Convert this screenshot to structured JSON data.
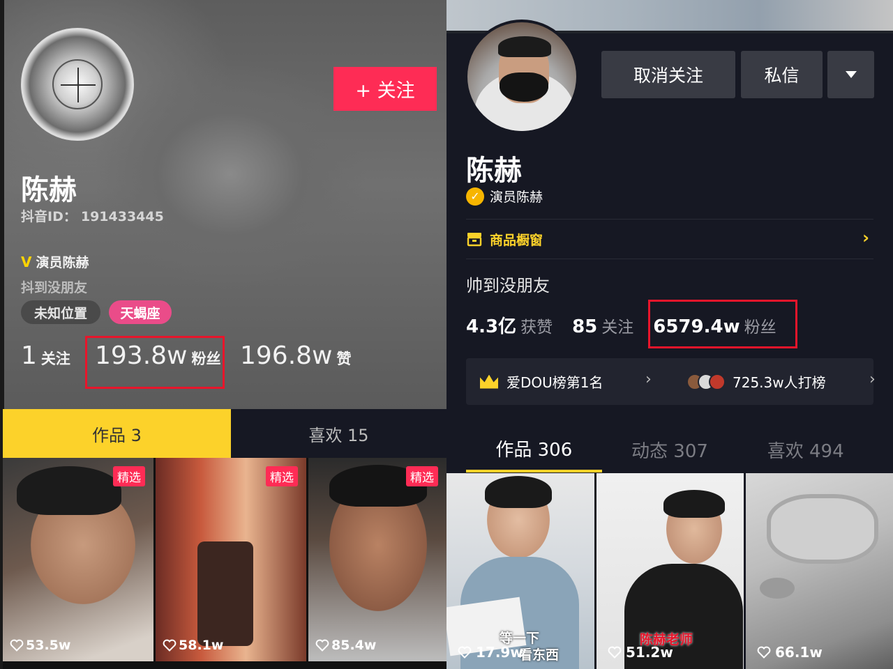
{
  "left": {
    "follow_button": "+ 关注",
    "name": "陈赫",
    "douyin_id_label": "抖音ID：",
    "douyin_id": "191433445",
    "verify_mark": "V",
    "verify_text": "演员陈赫",
    "bio": "抖到没朋友",
    "tags": [
      "未知位置",
      "天蝎座"
    ],
    "stats": [
      {
        "num": "1",
        "unit": "关注"
      },
      {
        "num": "193.8w",
        "unit": "粉丝"
      },
      {
        "num": "196.8w",
        "unit": "赞"
      }
    ],
    "tabs": [
      "作品 3",
      "喜欢 15"
    ],
    "videos": [
      {
        "badge": "精选",
        "likes": "53.5w"
      },
      {
        "badge": "精选",
        "likes": "58.1w"
      },
      {
        "badge": "精选",
        "likes": "85.4w"
      }
    ]
  },
  "right": {
    "buttons": {
      "unfollow": "取消关注",
      "message": "私信"
    },
    "name": "陈赫",
    "verify_text": "演员陈赫",
    "shop_label": "商品橱窗",
    "bio": "帅到没朋友",
    "stats": [
      {
        "num": "4.3亿",
        "unit": "获赞"
      },
      {
        "num": "85",
        "unit": "关注"
      },
      {
        "num": "6579.4w",
        "unit": "粉丝"
      }
    ],
    "rank": {
      "crown_num": "1",
      "label": "爱DOU榜第1名",
      "supporters": "725.3w人打榜"
    },
    "tabs": [
      "作品 306",
      "动态 307",
      "喜欢 494"
    ],
    "videos": [
      {
        "likes": "17.9w",
        "caption_line1": "等一下",
        "caption_line2": "看东西"
      },
      {
        "likes": "51.2w",
        "caption": "陈赫老师"
      },
      {
        "likes": "66.1w"
      }
    ]
  },
  "colors": {
    "accent_red": "#fe2c55",
    "accent_yellow": "#fcd22a",
    "highlight_box": "#e8152b",
    "dark_bg": "#161823"
  }
}
